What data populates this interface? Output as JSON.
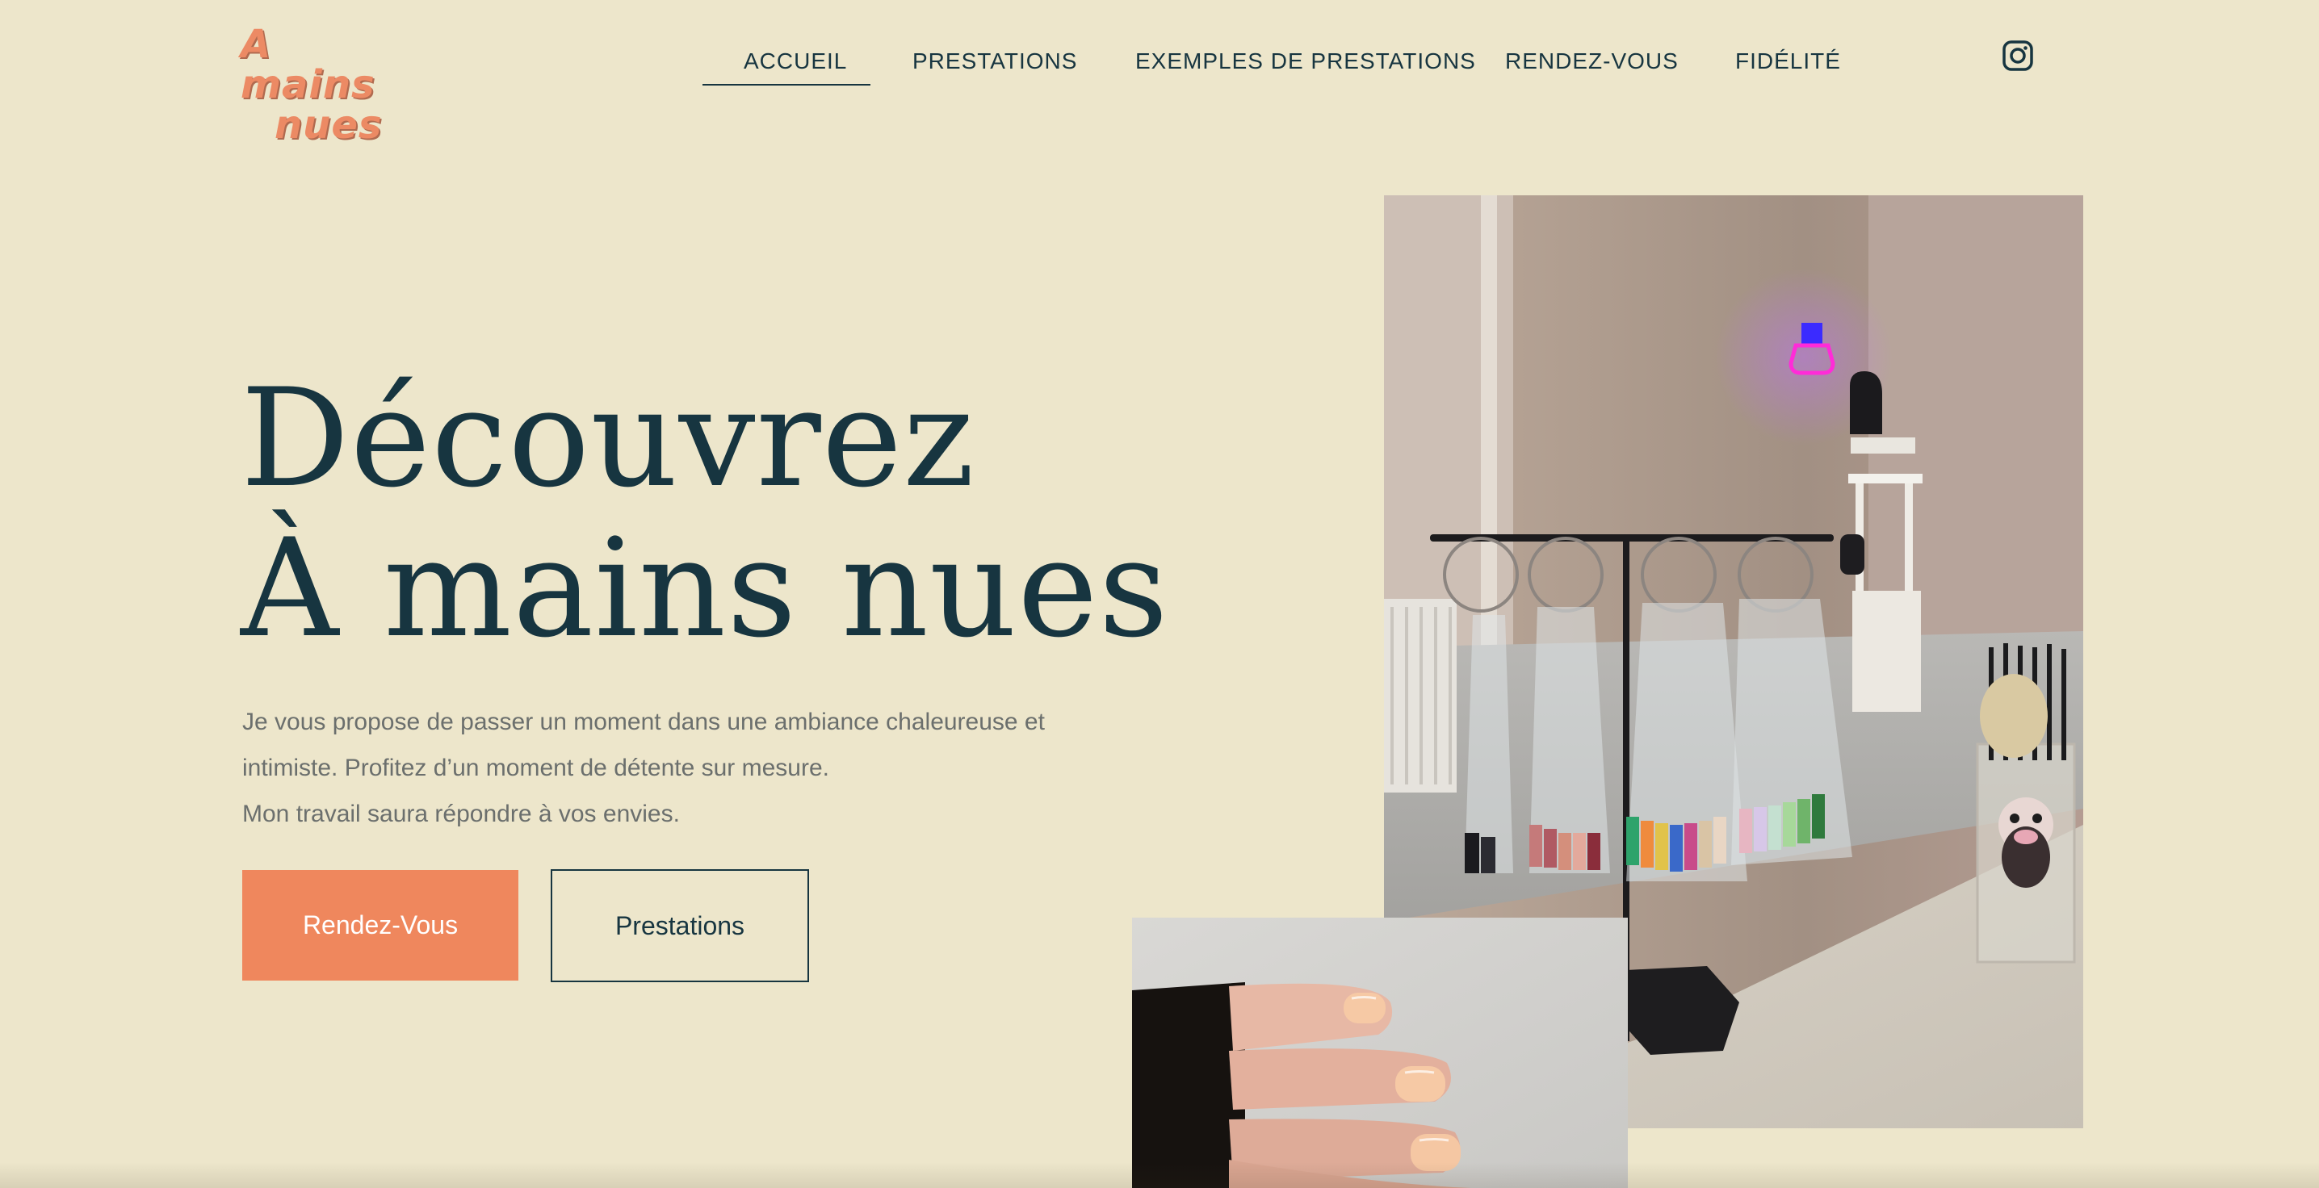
{
  "logo": {
    "line1": "A mains",
    "line2": "nues"
  },
  "nav": {
    "items": [
      {
        "label": "ACCUEIL",
        "active": true
      },
      {
        "label": "PRESTATIONS",
        "active": false
      },
      {
        "label": "EXEMPLES DE PRESTATIONS",
        "active": false
      },
      {
        "label": "RENDEZ-VOUS",
        "active": false
      },
      {
        "label": "FIDÉLITÉ",
        "active": false
      }
    ],
    "social_icon": "instagram-icon"
  },
  "hero": {
    "title_line1": "Découvrez",
    "title_line2": "À mains nues",
    "intro_line1": "Je vous propose de passer un moment dans une ambiance chaleureuse et",
    "intro_line2": "intimiste. Profitez d’un moment de détente sur mesure.",
    "intro_line3": "Mon travail saura répondre à vos envies.",
    "primary_button": "Rendez-Vous",
    "secondary_button": "Prestations"
  },
  "colors": {
    "background": "#ede6cb",
    "text": "#173540",
    "accent": "#ef875d",
    "muted_text": "#6b6f6d"
  }
}
